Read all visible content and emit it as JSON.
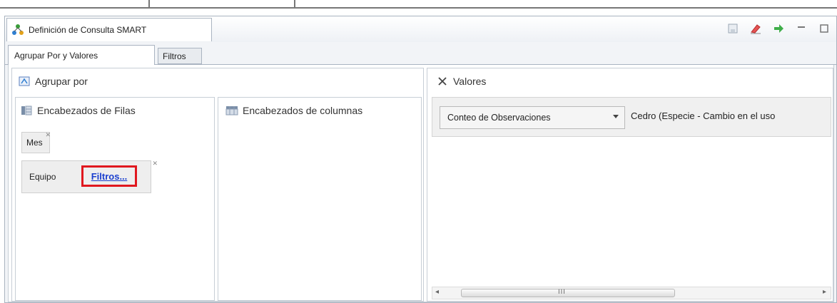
{
  "window": {
    "title": "Definición de Consulta SMART"
  },
  "title_actions": [
    {
      "name": "save-icon"
    },
    {
      "name": "clear-icon"
    },
    {
      "name": "run-icon"
    },
    {
      "name": "minimize-icon"
    },
    {
      "name": "maximize-icon"
    }
  ],
  "tabs": [
    {
      "label": "Agrupar Por y Valores",
      "active": true
    },
    {
      "label": "Filtros",
      "active": false
    }
  ],
  "group_by": {
    "header": "Agrupar por",
    "rows_panel": {
      "header": "Encabezados de Filas",
      "chips": [
        {
          "label": "Mes"
        },
        {
          "label": "Equipo",
          "link": "Filtros..."
        }
      ]
    },
    "columns_panel": {
      "header": "Encabezados de columnas"
    }
  },
  "values": {
    "header": "Valores",
    "dropdown": {
      "selected": "Conteo de Observaciones"
    },
    "value_label": "Cedro (Especie - Cambio en el uso",
    "scrollbar": {
      "grip": "III"
    }
  },
  "colors": {
    "highlight": "#e0181f",
    "link": "#1a3fcf"
  }
}
